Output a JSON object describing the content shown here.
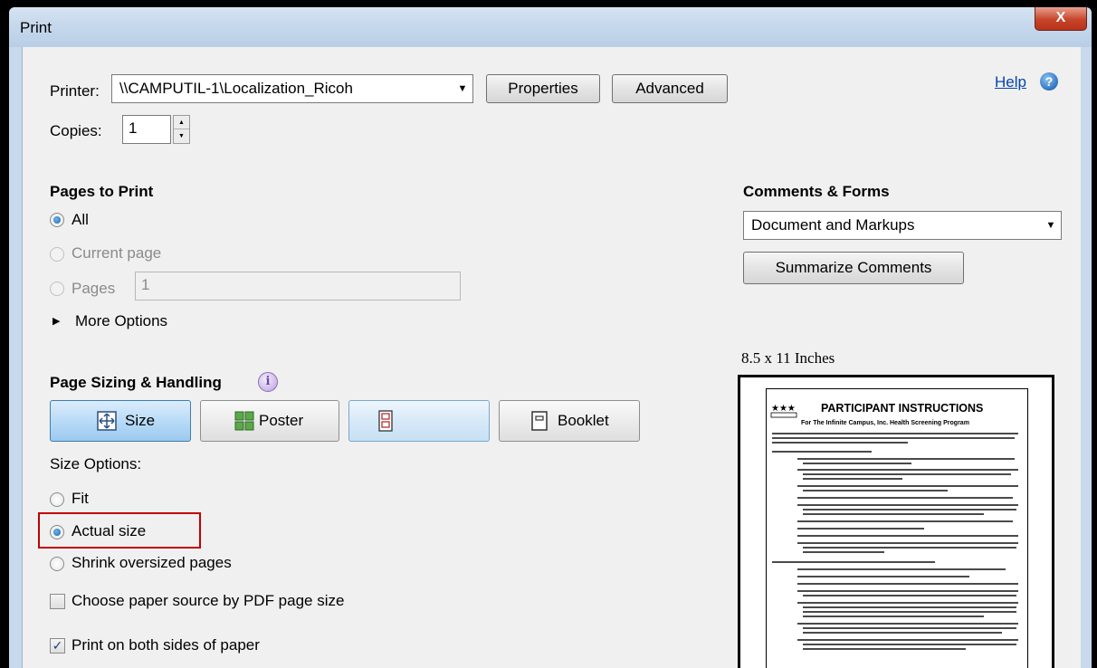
{
  "window": {
    "title": "Print",
    "close_label": "X"
  },
  "printer": {
    "label": "Printer:",
    "value": "\\\\CAMPUTIL-1\\Localization_Ricoh",
    "properties_label": "Properties",
    "advanced_label": "Advanced",
    "help_label": "Help",
    "help_icon": "help-question-icon"
  },
  "copies": {
    "label": "Copies:",
    "value": "1"
  },
  "pages_to_print": {
    "heading": "Pages to Print",
    "all_label": "All",
    "current_label": "Current page",
    "pages_label": "Pages",
    "pages_value": "1",
    "more_options_label": "More Options",
    "selected": "All"
  },
  "page_sizing": {
    "heading": "Page Sizing & Handling",
    "modes": [
      {
        "label": "Size",
        "icon": "size-arrows-icon",
        "active": true
      },
      {
        "label": "Poster",
        "icon": "poster-tiles-icon",
        "active": false
      },
      {
        "label": "",
        "icon": "multiple-pages-icon",
        "active": false
      },
      {
        "label": "Booklet",
        "icon": "booklet-icon",
        "active": false
      }
    ],
    "size_options_label": "Size Options:",
    "fit_label": "Fit",
    "actual_label": "Actual size",
    "shrink_label": "Shrink oversized pages",
    "selected": "Actual size",
    "choose_paper_label": "Choose paper source by PDF page size",
    "choose_paper_checked": false,
    "both_sides_label": "Print on both sides of paper",
    "both_sides_checked": true
  },
  "comments_forms": {
    "heading": "Comments & Forms",
    "value": "Document and Markups",
    "summarize_label": "Summarize Comments"
  },
  "preview": {
    "size_label": "8.5 x 11 Inches",
    "doc_title": "PARTICIPANT INSTRUCTIONS",
    "doc_subtitle": "For The Infinite Campus, Inc. Health Screening Program"
  },
  "colors": {
    "accent": "#3c7fb1",
    "highlight": "#c00000",
    "link": "#0645ad"
  }
}
